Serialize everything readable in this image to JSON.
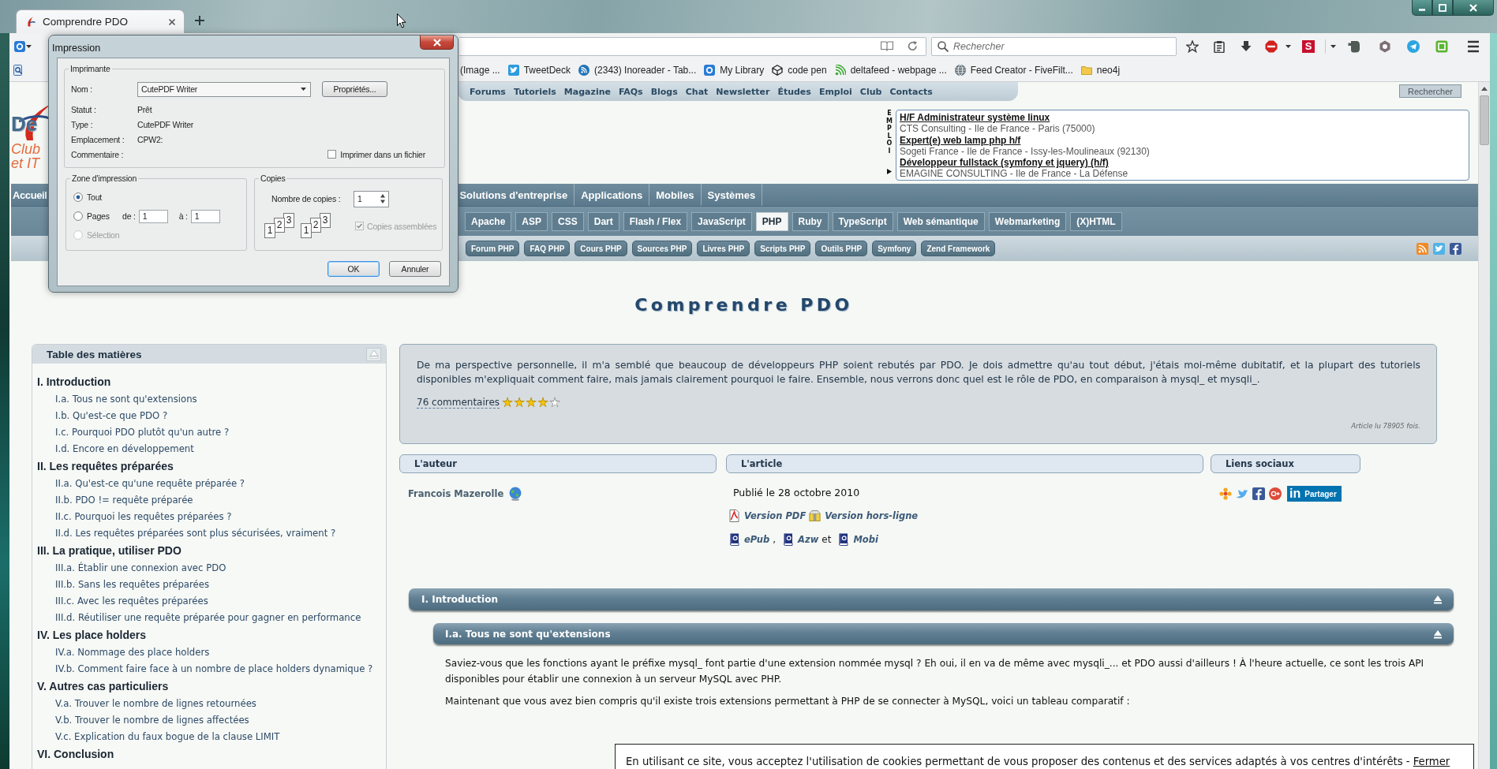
{
  "browser": {
    "tabs": [
      {
        "label": "Comprendre PDO",
        "selected": true
      }
    ],
    "search": {
      "placeholder": "Rechercher"
    },
    "extension_letter": "S",
    "bookmarks": [
      {
        "kind": "history"
      },
      {
        "label": "(Image ..."
      },
      {
        "kind": "bird",
        "label": "TweetDeck"
      },
      {
        "kind": "feed",
        "label": "(2343) Inoreader - Tab..."
      },
      {
        "kind": "tile",
        "label": "My Library"
      },
      {
        "kind": "cube",
        "label": "code pen"
      },
      {
        "kind": "signal",
        "label": "deltafeed - webpage ..."
      },
      {
        "kind": "globe",
        "label": "Feed Creator - FiveFilt..."
      },
      {
        "kind": "folder",
        "label": "neo4j"
      }
    ]
  },
  "print_dialog": {
    "title": "Impression",
    "printer_group": "Imprimante",
    "name_label": "Nom :",
    "printer": "CutePDF Writer",
    "properties_button": "Propriétés...",
    "details": [
      {
        "label": "Statut :",
        "value": "Prêt"
      },
      {
        "label": "Type :",
        "value": "CutePDF Writer"
      },
      {
        "label": "Emplacement :",
        "value": "CPW2:"
      },
      {
        "label": "Commentaire :"
      }
    ],
    "print_to_file": {
      "label": "Imprimer dans un fichier",
      "checked": false
    },
    "range_group": "Zone d'impression",
    "range_options": [
      {
        "label": "Tout",
        "selected": true,
        "disabled": false
      },
      {
        "label": "Pages",
        "selected": false,
        "disabled": false
      },
      {
        "label": "Sélection",
        "selected": false,
        "disabled": true
      }
    ],
    "pages_from": {
      "label": "de :",
      "value": "1"
    },
    "pages_to": {
      "label": "à :",
      "value": "1"
    },
    "copies_group": "Copies",
    "copies_label": "Nombre de copies :",
    "copies_value": "1",
    "collate_sets": [
      [
        "1",
        "2",
        "3"
      ],
      [
        "1",
        "2",
        "3"
      ]
    ],
    "collate": {
      "label": "Copies assemblées",
      "checked": true,
      "disabled": true
    },
    "buttons": [
      {
        "label": "OK",
        "default": true
      },
      {
        "label": "Annuler",
        "default": false
      }
    ]
  },
  "site": {
    "logo": {
      "name": "De",
      "tagline": [
        "Club",
        "et IT"
      ]
    },
    "top_menu": [
      "Forums",
      "Tutoriels",
      "Magazine",
      "FAQs",
      "Blogs",
      "Chat",
      "Newsletter",
      "Études",
      "Emploi",
      "Club",
      "Contacts"
    ],
    "search_button": "Rechercher",
    "jobs": {
      "label": "EMPLOI",
      "items": [
        {
          "title": "H/F Administrateur système linux",
          "company": "CTS Consulting - Ile de France - Paris (75000)"
        },
        {
          "title": "Expert(e) web lamp php h/f",
          "company": "Sogeti France - Ile de France - Issy-les-Moulineaux (92130)"
        },
        {
          "title": "Développeur fullstack (symfony et jquery) (h/f)",
          "company": "EMAGINE CONSULTING - Ile de France - La Défense"
        }
      ]
    },
    "nav": [
      {
        "label": "Accueil",
        "selected": false
      },
      {
        "label": "Solutions d'entreprise",
        "selected": false
      },
      {
        "label": "Applications",
        "selected": false
      },
      {
        "label": "Mobiles",
        "selected": false
      },
      {
        "label": "Systèmes",
        "selected": false
      }
    ],
    "subnav": [
      {
        "label": "Apache",
        "selected": false
      },
      {
        "label": "ASP",
        "selected": false
      },
      {
        "label": "CSS",
        "selected": false
      },
      {
        "label": "Dart",
        "selected": false
      },
      {
        "label": "Flash / Flex",
        "selected": false
      },
      {
        "label": "JavaScript",
        "selected": false
      },
      {
        "label": "PHP",
        "selected": true
      },
      {
        "label": "Ruby",
        "selected": false
      },
      {
        "label": "TypeScript",
        "selected": false
      },
      {
        "label": "Web sémantique",
        "selected": false
      },
      {
        "label": "Webmarketing",
        "selected": false
      },
      {
        "label": "(X)HTML",
        "selected": false
      }
    ],
    "tools": [
      "Forum PHP",
      "FAQ PHP",
      "Cours PHP",
      "Sources PHP",
      "Livres PHP",
      "Scripts PHP",
      "Outils PHP",
      "Symfony",
      "Zend Framework"
    ],
    "title": "Comprendre PDO",
    "toc": {
      "title": "Table des matières",
      "sections": [
        {
          "title": "I. Introduction",
          "children": [
            {
              "title": "I.a. Tous ne sont qu'extensions"
            },
            {
              "title": "I.b. Qu'est-ce que PDO ?"
            },
            {
              "title": "I.c. Pourquoi PDO plutôt qu'un autre ?"
            },
            {
              "title": "I.d. Encore en développement"
            }
          ]
        },
        {
          "title": "II. Les requêtes préparées",
          "children": [
            {
              "title": "II.a. Qu'est-ce qu'une requête préparée ?"
            },
            {
              "title": "II.b. PDO != requête préparée"
            },
            {
              "title": "II.c. Pourquoi les requêtes préparées ?"
            },
            {
              "title": "II.d. Les requêtes préparées sont plus sécurisées, vraiment ?"
            }
          ]
        },
        {
          "title": "III. La pratique, utiliser PDO",
          "children": [
            {
              "title": "III.a. Établir une connexion avec PDO"
            },
            {
              "title": "III.b. Sans les requêtes préparées"
            },
            {
              "title": "III.c. Avec les requêtes préparées"
            },
            {
              "title": "III.d. Réutiliser une requête préparée pour gagner en performance"
            }
          ]
        },
        {
          "title": "IV. Les place holders",
          "children": [
            {
              "title": "IV.a. Nommage des place holders"
            },
            {
              "title": "IV.b. Comment faire face à un nombre de place holders dynamique ?"
            }
          ]
        },
        {
          "title": "V. Autres cas particuliers",
          "children": [
            {
              "title": "V.a. Trouver le nombre de lignes retournées"
            },
            {
              "title": "V.b. Trouver le nombre de lignes affectées"
            },
            {
              "title": "V.c. Explication du faux bogue de la clause LIMIT"
            }
          ]
        },
        {
          "title": "VI. Conclusion"
        }
      ]
    },
    "abstract": {
      "text": "De ma perspective personnelle, il m'a semblé que beaucoup de développeurs PHP soient rebutés par PDO. Je dois admettre qu'au tout début, j'étais moi-même dubitatif, et la plupart des tutoriels disponibles m'expliquait comment faire, mais jamais clairement pourquoi le faire. Ensemble, nous verrons donc quel est le rôle de PDO, en comparaison à mysql_ et mysqli_.",
      "comments": "76 commentaires",
      "stars": 4,
      "views": "Article lu 78905 fois."
    },
    "author": {
      "heading": "L'auteur",
      "name": "Francois Mazerolle"
    },
    "article": {
      "heading": "L'article",
      "published": "Publié le 28 octobre 2010",
      "versions": [
        {
          "kind": "pdf",
          "label": "Version PDF"
        },
        {
          "kind": "archive",
          "label": "Version hors-ligne"
        }
      ],
      "ebooks": [
        {
          "label": "ePub",
          "separator": ","
        },
        {
          "label": "Azw",
          "separator": "et"
        },
        {
          "label": "Mobi"
        }
      ]
    },
    "social": {
      "heading": "Liens sociaux",
      "share_logo": "in",
      "share_label": "Partager"
    },
    "sections": [
      {
        "title": "I. Introduction",
        "children": [
          {
            "title": "I.a. Tous ne sont qu'extensions",
            "paragraphs": [
              "Saviez-vous que les fonctions ayant le préfixe mysql_ font partie d'une extension nommée mysql ? Eh oui, il en va de même avec mysqli_... et PDO aussi d'ailleurs ! À l'heure actuelle, ce sont les trois API disponibles pour établir une connexion à un serveur MySQL avec PHP.",
              "Maintenant que vous avez bien compris qu'il existe trois extensions permettant à PHP de se connecter à MySQL, voici un tableau comparatif :"
            ]
          }
        ]
      }
    ]
  },
  "cookie_banner": {
    "text": "En utilisant ce site, vous acceptez l'utilisation de cookies permettant de vous proposer des contenus et des services adaptés à vos centres d'intérêts -",
    "link": "Fermer"
  }
}
